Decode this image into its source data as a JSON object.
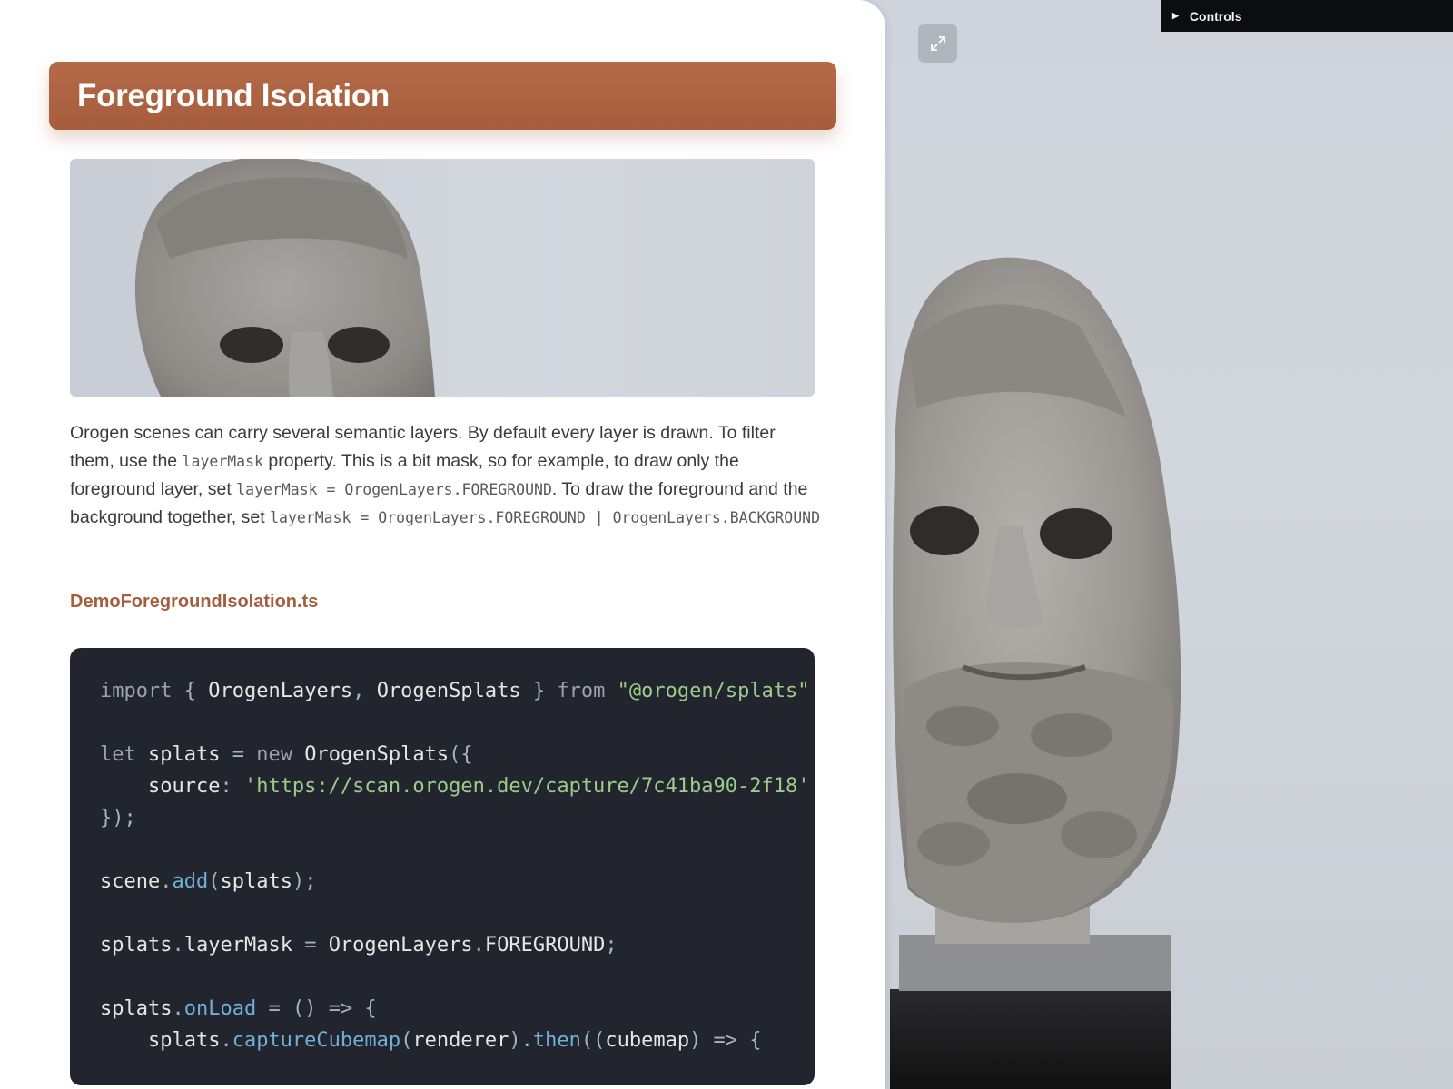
{
  "viewport": {
    "expand_icon": "expand-arrows-icon",
    "controls_label": "Controls",
    "controls_icon": "triangle-right-icon"
  },
  "section": {
    "title": "Foreground Isolation",
    "description": [
      {
        "t": "text",
        "v": "Orogen scenes can carry several semantic layers. By default every layer is drawn. To filter them, use the "
      },
      {
        "t": "code",
        "v": "layerMask"
      },
      {
        "t": "text",
        "v": " property. This is a bit mask, so for example, to draw only the foreground layer, set "
      },
      {
        "t": "code",
        "v": "layerMask = OrogenLayers.FOREGROUND"
      },
      {
        "t": "text",
        "v": ". To draw the foreground and the background together, set "
      },
      {
        "t": "code",
        "v": "layerMask = OrogenLayers.FOREGROUND | OrogenLayers.BACKGROUND"
      }
    ],
    "file_name": "DemoForegroundIsolation.ts",
    "code_lines": [
      [
        [
          "k",
          "import"
        ],
        [
          "p",
          " { "
        ],
        [
          "x",
          "OrogenLayers"
        ],
        [
          "p",
          ", "
        ],
        [
          "x",
          "OrogenSplats"
        ],
        [
          "p",
          " } "
        ],
        [
          "k",
          "from"
        ],
        [
          "x",
          " "
        ],
        [
          "s",
          "\"@orogen/splats\""
        ]
      ],
      [],
      [
        [
          "k",
          "let"
        ],
        [
          "x",
          " splats "
        ],
        [
          "p",
          "= "
        ],
        [
          "k",
          "new"
        ],
        [
          "x",
          " OrogenSplats"
        ],
        [
          "p",
          "({"
        ]
      ],
      [
        [
          "x",
          "    source"
        ],
        [
          "p",
          ": "
        ],
        [
          "s",
          "'https://scan.orogen.dev/capture/7c41ba90-2f18'"
        ]
      ],
      [
        [
          "p",
          "});"
        ]
      ],
      [],
      [
        [
          "x",
          "scene"
        ],
        [
          "p",
          "."
        ],
        [
          "f",
          "add"
        ],
        [
          "p",
          "("
        ],
        [
          "x",
          "splats"
        ],
        [
          "p",
          ");"
        ]
      ],
      [],
      [
        [
          "x",
          "splats"
        ],
        [
          "p",
          "."
        ],
        [
          "x",
          "layerMask "
        ],
        [
          "p",
          "= "
        ],
        [
          "x",
          "OrogenLayers"
        ],
        [
          "p",
          "."
        ],
        [
          "x",
          "FOREGROUND"
        ],
        [
          "p",
          ";"
        ]
      ],
      [],
      [
        [
          "x",
          "splats"
        ],
        [
          "p",
          "."
        ],
        [
          "f",
          "onLoad"
        ],
        [
          "p",
          " = () => {"
        ]
      ],
      [
        [
          "x",
          "    splats"
        ],
        [
          "p",
          "."
        ],
        [
          "f",
          "captureCubemap"
        ],
        [
          "p",
          "("
        ],
        [
          "x",
          "renderer"
        ],
        [
          "p",
          ")."
        ],
        [
          "f",
          "then"
        ],
        [
          "p",
          "(("
        ],
        [
          "x",
          "cubemap"
        ],
        [
          "p",
          ") => {"
        ]
      ]
    ]
  }
}
